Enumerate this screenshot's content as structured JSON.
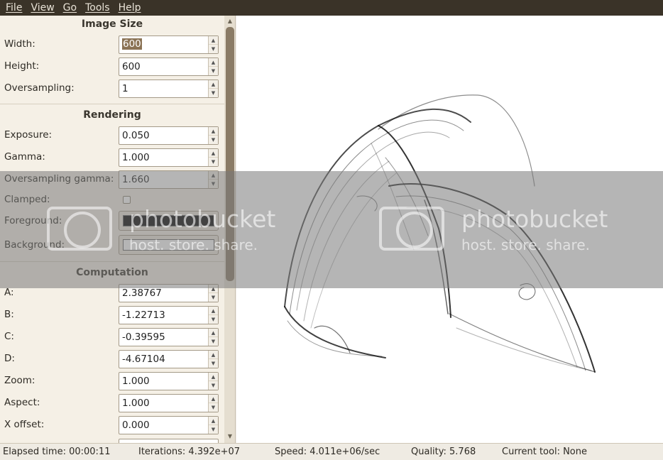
{
  "menubar": {
    "items": [
      {
        "label": "File"
      },
      {
        "label": "View"
      },
      {
        "label": "Go"
      },
      {
        "label": "Tools"
      },
      {
        "label": "Help"
      }
    ]
  },
  "sections": {
    "image_size": {
      "title": "Image Size",
      "width": {
        "label": "Width:",
        "value": "600"
      },
      "height": {
        "label": "Height:",
        "value": "600"
      },
      "oversampling": {
        "label": "Oversampling:",
        "value": "1"
      }
    },
    "rendering": {
      "title": "Rendering",
      "exposure": {
        "label": "Exposure:",
        "value": "0.050"
      },
      "gamma": {
        "label": "Gamma:",
        "value": "1.000"
      },
      "oversampling_gamma": {
        "label": "Oversampling gamma:",
        "value": "1.660"
      },
      "clamped": {
        "label": "Clamped:",
        "checked": false
      },
      "foreground": {
        "label": "Foreground:",
        "color": "#000000"
      },
      "background": {
        "label": "Background:",
        "color": "#ffffff"
      }
    },
    "computation": {
      "title": "Computation",
      "a": {
        "label": "A:",
        "value": "2.38767"
      },
      "b": {
        "label": "B:",
        "value": "-1.22713"
      },
      "c": {
        "label": "C:",
        "value": "-0.39595"
      },
      "d": {
        "label": "D:",
        "value": "-4.67104"
      },
      "zoom": {
        "label": "Zoom:",
        "value": "1.000"
      },
      "aspect": {
        "label": "Aspect:",
        "value": "1.000"
      },
      "x_offset": {
        "label": "X offset:",
        "value": "0.000"
      }
    }
  },
  "watermark": {
    "brand": "photobucket",
    "tagline": "host. store. share."
  },
  "statusbar": {
    "elapsed": "Elapsed time: 00:00:11",
    "iterations": "Iterations: 4.392e+07",
    "speed": "Speed: 4.011e+06/sec",
    "quality": "Quality: 5.768",
    "tool": "Current tool: None"
  },
  "colors": {
    "menubar_bg": "#3a3328",
    "panel_bg": "#f5f0e6",
    "scroll_thumb": "#8a7b66",
    "selection": "#8b7355"
  }
}
